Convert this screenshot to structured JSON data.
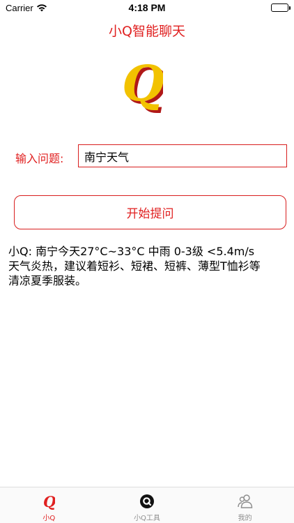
{
  "status_bar": {
    "carrier": "Carrier",
    "time": "4:18 PM"
  },
  "nav": {
    "title": "小Q智能聊天"
  },
  "logo": {
    "letter": "Q"
  },
  "question": {
    "label": "输入问题:",
    "value": "南宁天气"
  },
  "ask_button": {
    "label": "开始提问"
  },
  "answer": {
    "lines": [
      "小Q: 南宁今天27°C~33°C 中雨 0-3级 <5.4m/s",
      "天气炎热，建议着短衫、短裙、短裤、薄型T恤衫等",
      "清凉夏季服装。"
    ]
  },
  "tabs": [
    {
      "label": "小Q",
      "icon": "q-logo-icon",
      "active": true
    },
    {
      "label": "小Q工具",
      "icon": "q-tools-icon",
      "active": false
    },
    {
      "label": "我的",
      "icon": "user-group-icon",
      "active": false
    }
  ],
  "colors": {
    "accent": "#e02020",
    "logo_front": "#f2c200",
    "logo_back": "#b01818",
    "tab_inactive": "#8e8e8e"
  }
}
